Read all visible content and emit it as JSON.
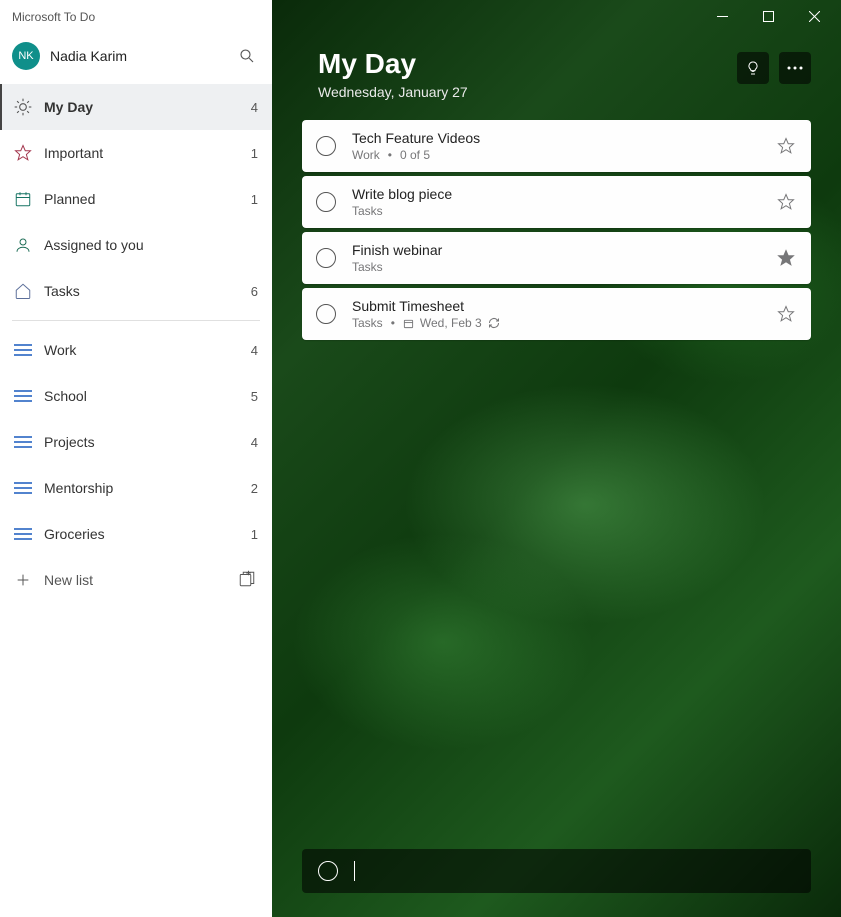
{
  "app_title": "Microsoft To Do",
  "user": {
    "initials": "NK",
    "name": "Nadia Karim"
  },
  "smart_lists": [
    {
      "id": "myday",
      "label": "My Day",
      "count": "4",
      "active": true,
      "icon": "sun"
    },
    {
      "id": "important",
      "label": "Important",
      "count": "1",
      "icon": "star"
    },
    {
      "id": "planned",
      "label": "Planned",
      "count": "1",
      "icon": "calendar"
    },
    {
      "id": "assigned",
      "label": "Assigned to you",
      "count": "",
      "icon": "person"
    },
    {
      "id": "tasks",
      "label": "Tasks",
      "count": "6",
      "icon": "home"
    }
  ],
  "custom_lists": [
    {
      "id": "work",
      "label": "Work",
      "count": "4"
    },
    {
      "id": "school",
      "label": "School",
      "count": "5"
    },
    {
      "id": "projects",
      "label": "Projects",
      "count": "4"
    },
    {
      "id": "mentorship",
      "label": "Mentorship",
      "count": "2"
    },
    {
      "id": "groceries",
      "label": "Groceries",
      "count": "1"
    }
  ],
  "new_list_label": "New list",
  "header": {
    "title": "My Day",
    "date": "Wednesday, January 27"
  },
  "tasks": [
    {
      "title": "Tech Feature Videos",
      "list": "Work",
      "extra": "0 of 5",
      "starred": false
    },
    {
      "title": "Write blog piece",
      "list": "Tasks",
      "extra": "",
      "starred": false
    },
    {
      "title": "Finish webinar",
      "list": "Tasks",
      "extra": "",
      "starred": true
    },
    {
      "title": "Submit Timesheet",
      "list": "Tasks",
      "extra": "",
      "due": "Wed, Feb 3",
      "recurring": true,
      "starred": false
    }
  ],
  "add_task_placeholder": "",
  "colors": {
    "accent": "#185abd",
    "avatar": "#0f8f8a",
    "starred": "#767678"
  }
}
